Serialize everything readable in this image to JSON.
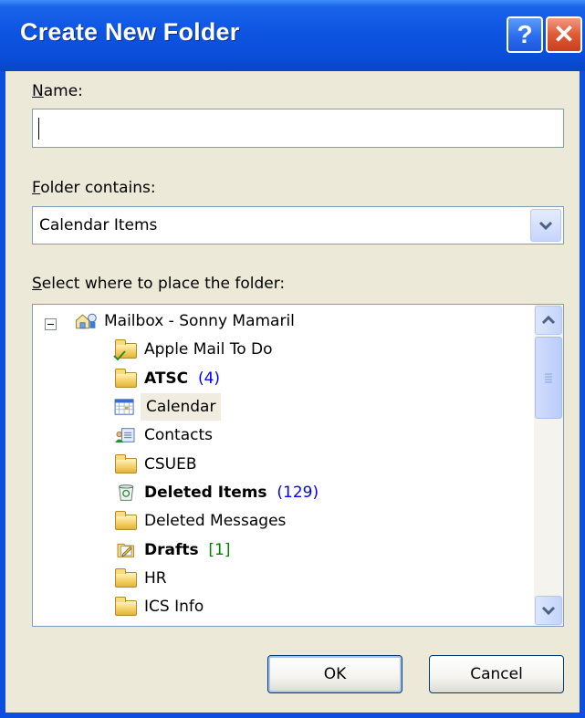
{
  "window": {
    "title": "Create New Folder",
    "help_label": "?",
    "close_label": "✕"
  },
  "name_field": {
    "label_access": "N",
    "label_rest": "ame:",
    "value": ""
  },
  "folder_contains": {
    "label_access": "F",
    "label_rest": "older contains:",
    "selected": "Calendar Items"
  },
  "location": {
    "label_access": "S",
    "label_rest": "elect where to place the folder:"
  },
  "tree": {
    "root": "Mailbox - Sonny Mamaril",
    "items": [
      {
        "name": "Apple Mail To Do",
        "count": ""
      },
      {
        "name": "ATSC",
        "count": "(4)"
      },
      {
        "name": "Calendar",
        "count": ""
      },
      {
        "name": "Contacts",
        "count": ""
      },
      {
        "name": "CSUEB",
        "count": ""
      },
      {
        "name": "Deleted Items",
        "count": "(129)"
      },
      {
        "name": "Deleted Messages",
        "count": ""
      },
      {
        "name": "Drafts",
        "count": "[1]"
      },
      {
        "name": "HR",
        "count": ""
      },
      {
        "name": "ICS Info",
        "count": ""
      }
    ]
  },
  "buttons": {
    "ok": "OK",
    "cancel": "Cancel"
  },
  "colors": {
    "titlebar": "#0a4dd8",
    "dialog_bg": "#ece9d8",
    "count_blue": "#0000ff",
    "count_green": "#008000"
  },
  "icons": {
    "root": "mailbox-icon",
    "folder": "folder-icon",
    "calendar": "calendar-icon",
    "contacts": "contacts-icon",
    "deleted": "recycle-bin-icon",
    "drafts": "drafts-icon",
    "tasks": "tasks-folder-icon"
  }
}
